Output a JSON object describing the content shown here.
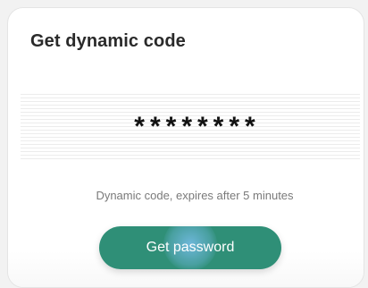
{
  "dialog": {
    "title": "Get dynamic code",
    "code_value": "********",
    "expiry_hint": "Dynamic code, expires after 5 minutes",
    "button_label": "Get password"
  },
  "colors": {
    "button": "#2f8f77",
    "ripple": "#78beeb"
  }
}
